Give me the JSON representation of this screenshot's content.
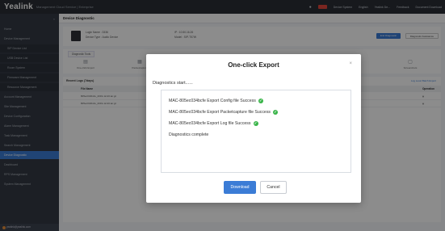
{
  "header": {
    "logo": "Yealink",
    "product": "Management Cloud Service | Enterprise",
    "user_menu": "Device System",
    "language": "English",
    "company": "Yealink De...",
    "feedback": "Feedback",
    "download": "Document Download"
  },
  "sidebar": {
    "items": [
      {
        "label": "Home",
        "sub": false,
        "active": false
      },
      {
        "label": "Device Management",
        "sub": false,
        "active": false
      },
      {
        "label": "SIP Device List",
        "sub": true,
        "active": false
      },
      {
        "label": "USB Device List",
        "sub": true,
        "active": false
      },
      {
        "label": "Room System",
        "sub": true,
        "active": false
      },
      {
        "label": "Firmware Management",
        "sub": true,
        "active": false
      },
      {
        "label": "Resource Management",
        "sub": true,
        "active": false
      },
      {
        "label": "Account Management",
        "sub": false,
        "active": false
      },
      {
        "label": "Site Management",
        "sub": false,
        "active": false
      },
      {
        "label": "Device Configuration",
        "sub": false,
        "active": false
      },
      {
        "label": "Alarm Management",
        "sub": false,
        "active": false
      },
      {
        "label": "Task Management",
        "sub": false,
        "active": false
      },
      {
        "label": "Search Management",
        "sub": false,
        "active": false
      },
      {
        "label": "Device Diagnostic",
        "sub": false,
        "active": true
      },
      {
        "label": "Dashboard",
        "sub": false,
        "active": false
      },
      {
        "label": "RPS Management",
        "sub": false,
        "active": false
      },
      {
        "label": "System Management",
        "sub": false,
        "active": false
      }
    ],
    "bottom_user": "yealink@yealink.com"
  },
  "page": {
    "title": "Device Diagnostic",
    "login_name": "Login Name : 3336",
    "device_type": "Device Type : Audio Device",
    "ip": "IP : 10.50.16.26",
    "model": "Model : SIP-T57W",
    "end_diagnostic": "End Diagnostic",
    "diagnostic_assistance": "Diagnostic Assistance",
    "tools_tab": "Diagnostic Tools",
    "tools": [
      {
        "label": "One-click Export",
        "icon": "export-icon"
      },
      {
        "label": "Packetcapture",
        "icon": "capture-icon"
      },
      {
        "label": "Recording File",
        "icon": "record-icon"
      },
      {
        "label": "Screenshots",
        "icon": "screenshot-icon"
      }
    ],
    "logs_title": "Recent Logs (7days)",
    "logs_actions": "Log Level  Batch Export",
    "logs_col_file": "File Name",
    "logs_col_op": "Operation",
    "logs_rows": [
      {
        "name": "805ec034bcfe_2019-12-20.tar.gz"
      },
      {
        "name": "805ec034bcfe_2019-12-20.tar.gz"
      }
    ]
  },
  "modal": {
    "title": "One-click Export",
    "close": "×",
    "diag_start": "Diagnostics start......",
    "lines": [
      {
        "text": "MAC-805ec034bcfe Export Config file Success",
        "ok": true
      },
      {
        "text": "MAC-805ec034bcfe Export Packetcapture file Success",
        "ok": true
      },
      {
        "text": "MAC-805ec034bcfe Export Log file Success",
        "ok": true
      },
      {
        "text": "Diagnostics complete",
        "ok": false
      }
    ],
    "download": "Download",
    "cancel": "Cancel"
  },
  "colors": {
    "accent": "#3b7cd6",
    "success": "#3ab54a",
    "sidebar": "#343a44",
    "topbar": "#2b2f36"
  }
}
